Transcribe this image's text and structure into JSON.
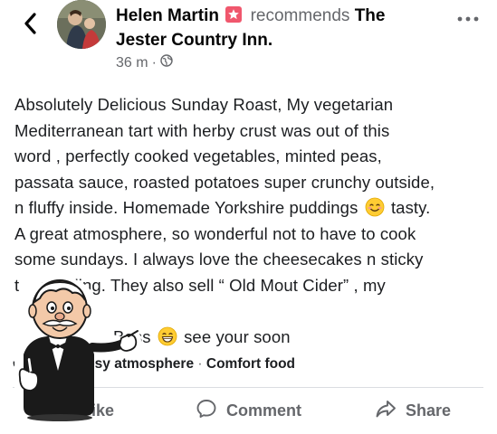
{
  "header": {
    "author": "Helen Martin",
    "verb": "recommends",
    "page_name_1": "The",
    "page_name_2": "Jester Country Inn.",
    "time": "36 m",
    "separator": "·",
    "icons": {
      "back": "back-chevron-icon",
      "badge": "star-badge-icon",
      "audience": "globe-icon",
      "more": "more-options-icon"
    }
  },
  "post": {
    "lines": [
      "Absolutely Delicious Sunday Roast, My vegetarian",
      "Mediterranean tart with herby crust was out of this",
      "word , perfectly cooked vegetables, minted peas,",
      "passata sauce, roasted potatoes super crunchy outside,",
      "n fluffy inside. Homemade Yorkshire puddings",
      "tasty.",
      "A great atmosphere, so wonderful not to have to cook",
      "some sundays. I always love the cheesecakes n sticky",
      "t",
      "pudding.  They also sell “ Old Mout Cider” , my",
      "T",
      "n Bass",
      "see your soon"
    ]
  },
  "tags": {
    "prefix": "C",
    "text": "osy atmosphere",
    "separator": "·",
    "second": "Comfort food"
  },
  "actions": {
    "like": "Like",
    "comment": "Comment",
    "share": "Share"
  },
  "colors": {
    "text": "#1c1e21",
    "secondary": "#65676b",
    "badge": "#f0576d",
    "emoji": "#ffcc33"
  }
}
